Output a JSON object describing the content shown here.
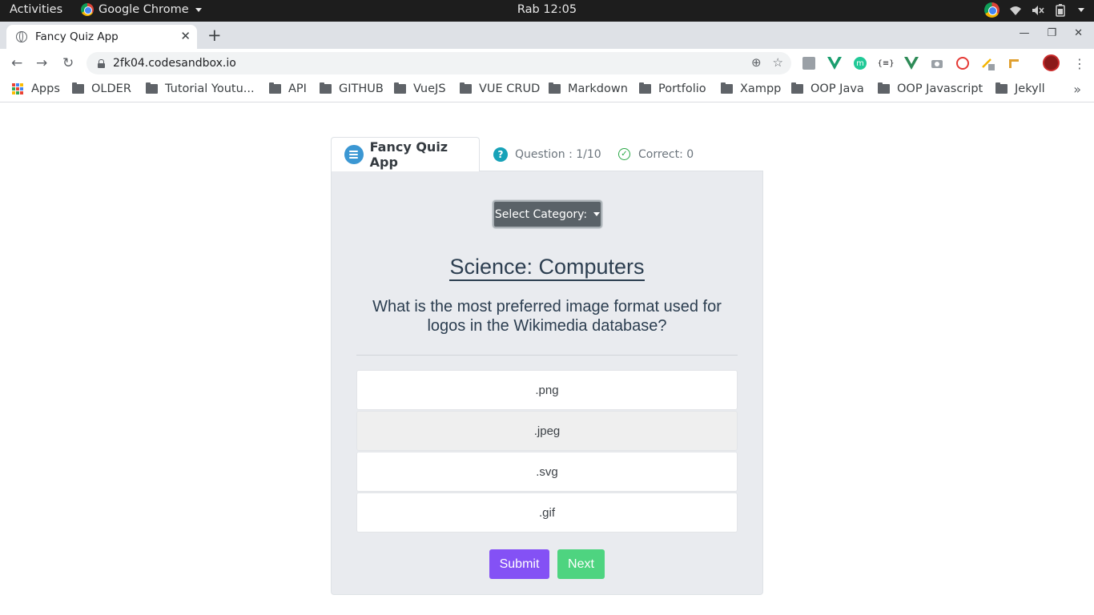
{
  "os": {
    "activities": "Activities",
    "app_name": "Google Chrome",
    "clock": "Rab 12:05"
  },
  "browser": {
    "tab_title": "Fancy Quiz App",
    "url": "2fk04.codesandbox.io",
    "bookmarks": [
      "Apps",
      "OLDER",
      "Tutorial Youtu...",
      "API",
      "GITHUB",
      "VueJS",
      "VUE CRUD",
      "Markdown",
      "Portfolio",
      "Xampp",
      "OOP Java",
      "OOP Javascript",
      "Jekyll"
    ]
  },
  "quiz": {
    "app_title": "Fancy Quiz App",
    "question_counter": "Question : 1/10",
    "correct_counter": "Correct: 0",
    "category_button": "Select Category:",
    "category": "Science: Computers",
    "question": "What is the most preferred image format used for logos in the Wikimedia database?",
    "answers": [
      ".png",
      ".jpeg",
      ".svg",
      ".gif"
    ],
    "submit_label": "Submit",
    "next_label": "Next"
  },
  "colors": {
    "submit": "#8451f5",
    "next": "#4ed480",
    "category_button": "#5a6268",
    "card_background": "#e9ebef"
  }
}
